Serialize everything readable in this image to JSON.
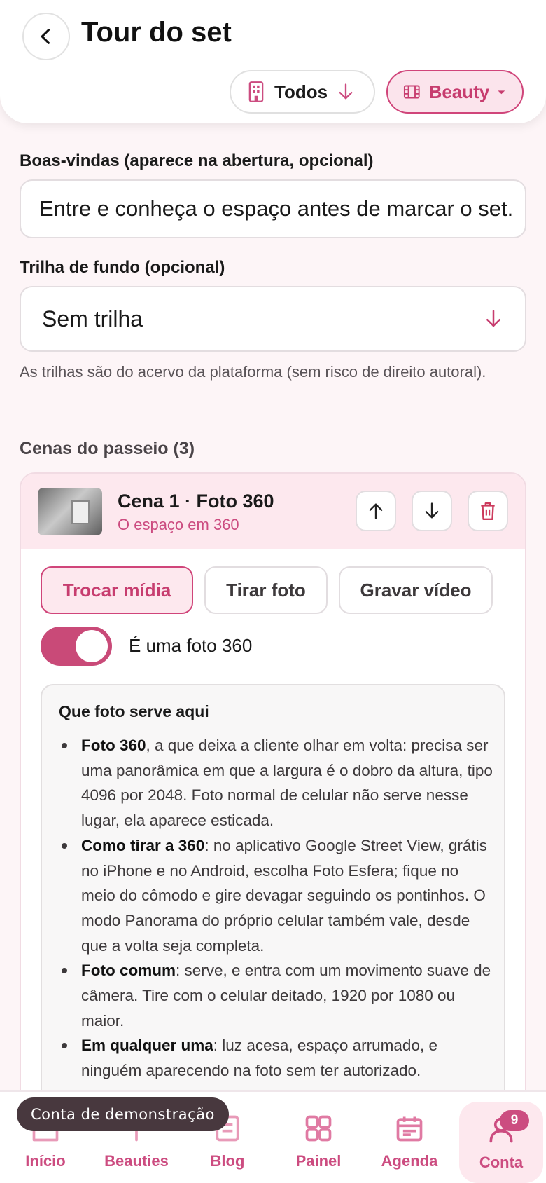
{
  "header": {
    "title": "Tour do set",
    "filter_all_label": "Todos",
    "filter_category_label": "Beauty"
  },
  "form": {
    "welcome_label": "Boas-vindas (aparece na abertura, opcional)",
    "welcome_value": "Entre e conheça o espaço antes de marcar o set.",
    "track_label": "Trilha de fundo (opcional)",
    "track_value": "Sem trilha",
    "track_helper": "As trilhas são do acervo da plataforma (sem risco de direito autoral).",
    "scenes_title": "Cenas do passeio (3)"
  },
  "scene": {
    "title": "Cena 1 · Foto 360",
    "subtitle": "O espaço em 360",
    "buttons": {
      "swap_media": "Trocar mídia",
      "take_photo": "Tirar foto",
      "record_video": "Gravar vídeo"
    },
    "toggle_label": "É uma foto 360",
    "toggle_on": true
  },
  "tips": {
    "title": "Que foto serve aqui",
    "items": [
      {
        "bold": "Foto 360",
        "text": ", a que deixa a cliente olhar em volta: precisa ser uma panorâmica em que a largura é o dobro da altura, tipo 4096 por 2048. Foto normal de celular não serve nesse lugar, ela aparece esticada."
      },
      {
        "bold": "Como tirar a 360",
        "text": ": no aplicativo Google Street View, grátis no iPhone e no Android, escolha Foto Esfera; fique no meio do cômodo e gire devagar seguindo os pontinhos. O modo Panorama do próprio celular também vale, desde que a volta seja completa."
      },
      {
        "bold": "Foto comum",
        "text": ": serve, e entra com um movimento suave de câmera. Tire com o celular deitado, 1920 por 1080 ou maior."
      },
      {
        "bold": "Em qualquer uma",
        "text": ": luz acesa, espaço arrumado, e ninguém aparecendo na foto sem ter autorizado."
      }
    ]
  },
  "demo_banner": "Conta de demonstração",
  "nav": {
    "items": [
      {
        "label": "Início",
        "icon": "home-icon"
      },
      {
        "label": "Beauties",
        "icon": "beauties-icon"
      },
      {
        "label": "Blog",
        "icon": "blog-icon"
      },
      {
        "label": "Painel",
        "icon": "dashboard-icon"
      },
      {
        "label": "Agenda",
        "icon": "calendar-icon"
      },
      {
        "label": "Conta",
        "icon": "user-icon"
      }
    ],
    "account_badge": "9"
  },
  "colors": {
    "accent": "#cc4c80",
    "accent_soft": "#fde8ee",
    "background": "#fdf5f7"
  }
}
